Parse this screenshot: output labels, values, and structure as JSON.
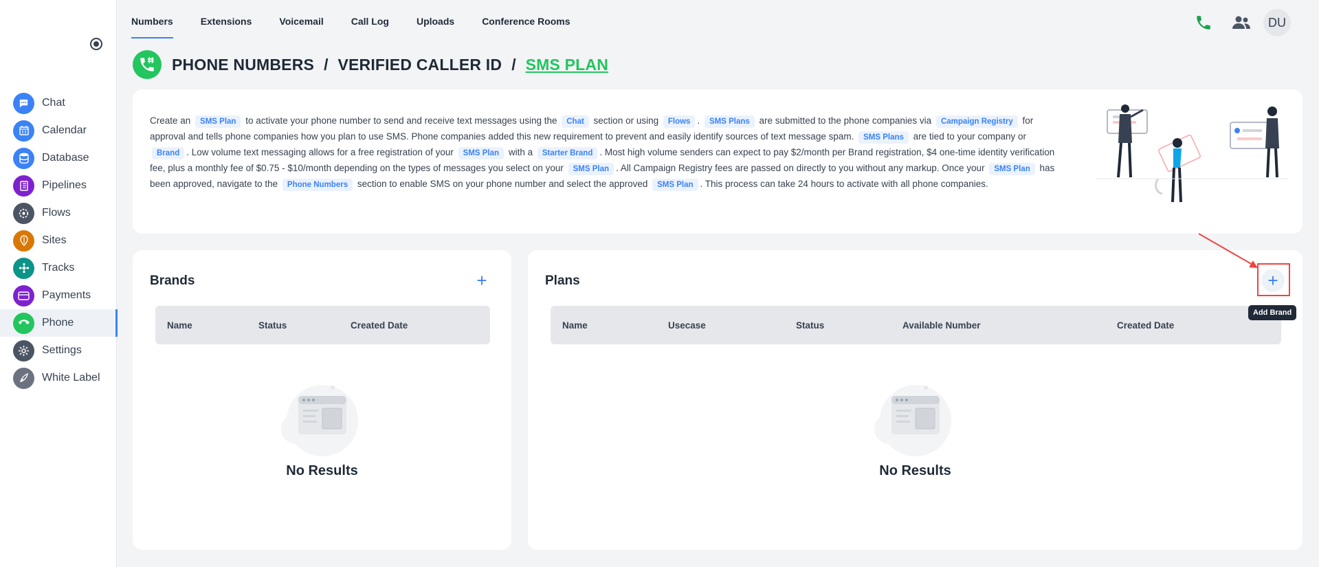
{
  "sidebar": {
    "items": [
      {
        "label": "Chat",
        "icon": "chat-icon",
        "color": "#3b82f6"
      },
      {
        "label": "Calendar",
        "icon": "calendar-icon",
        "color": "#3b82f6"
      },
      {
        "label": "Database",
        "icon": "database-icon",
        "color": "#3b82f6"
      },
      {
        "label": "Pipelines",
        "icon": "pipelines-icon",
        "color": "#7e22ce"
      },
      {
        "label": "Flows",
        "icon": "flows-icon",
        "color": "#4b5563"
      },
      {
        "label": "Sites",
        "icon": "sites-icon",
        "color": "#d97706"
      },
      {
        "label": "Tracks",
        "icon": "tracks-icon",
        "color": "#0d9488"
      },
      {
        "label": "Payments",
        "icon": "payments-icon",
        "color": "#7e22ce"
      },
      {
        "label": "Phone",
        "icon": "phone-icon",
        "color": "#22c55e"
      },
      {
        "label": "Settings",
        "icon": "gear-icon",
        "color": "#4b5563"
      },
      {
        "label": "White Label",
        "icon": "white-label-icon",
        "color": "#6b7280"
      }
    ],
    "active": "Phone"
  },
  "topnav": {
    "tabs": [
      "Numbers",
      "Extensions",
      "Voicemail",
      "Call Log",
      "Uploads",
      "Conference Rooms"
    ],
    "active": "Numbers",
    "avatar": "DU",
    "phone_color": "#16a34a"
  },
  "breadcrumb": {
    "items": [
      "PHONE NUMBERS",
      "VERIFIED CALLER ID",
      "SMS PLAN"
    ],
    "separator": "/"
  },
  "info": {
    "segments": [
      {
        "t": "Create an "
      },
      {
        "c": "SMS Plan"
      },
      {
        "t": " to activate your phone number to send and receive text messages using the "
      },
      {
        "c": "Chat"
      },
      {
        "t": " section or using "
      },
      {
        "c": "Flows"
      },
      {
        "t": ". "
      },
      {
        "c": "SMS Plans"
      },
      {
        "t": " are submitted to the phone companies via "
      },
      {
        "c": "Campaign Registry"
      },
      {
        "t": " for approval and tells phone companies how you plan to use SMS. Phone companies added this new requirement to prevent and easily identify sources of text message spam. "
      },
      {
        "c": "SMS Plans"
      },
      {
        "t": " are tied to your company or "
      },
      {
        "c": "Brand"
      },
      {
        "t": ". Low volume text messaging allows for a free registration of your "
      },
      {
        "c": "SMS Plan"
      },
      {
        "t": " with a "
      },
      {
        "c": "Starter Brand"
      },
      {
        "t": ". Most high volume senders can expect to pay $2/month per Brand registration, $4 one-time identity verification fee, plus a monthly fee of $0.75 - $10/month depending on the types of messages you select on your "
      },
      {
        "c": "SMS Plan"
      },
      {
        "t": ". All Campaign Registry fees are passed on directly to you without any markup. Once your "
      },
      {
        "c": "SMS Plan"
      },
      {
        "t": " has been approved, navigate to the "
      },
      {
        "c": "Phone Numbers"
      },
      {
        "t": " section to enable SMS on your phone number and select the approved "
      },
      {
        "c": "SMS Plan"
      },
      {
        "t": ". This process can take 24 hours to activate with all phone companies."
      }
    ]
  },
  "brands": {
    "title": "Brands",
    "columns": [
      "Name",
      "Status",
      "Created Date"
    ],
    "empty": "No Results"
  },
  "plans": {
    "title": "Plans",
    "columns": [
      "Name",
      "Usecase",
      "Status",
      "Available Number",
      "Created Date"
    ],
    "empty": "No Results",
    "tooltip": "Add Brand"
  }
}
